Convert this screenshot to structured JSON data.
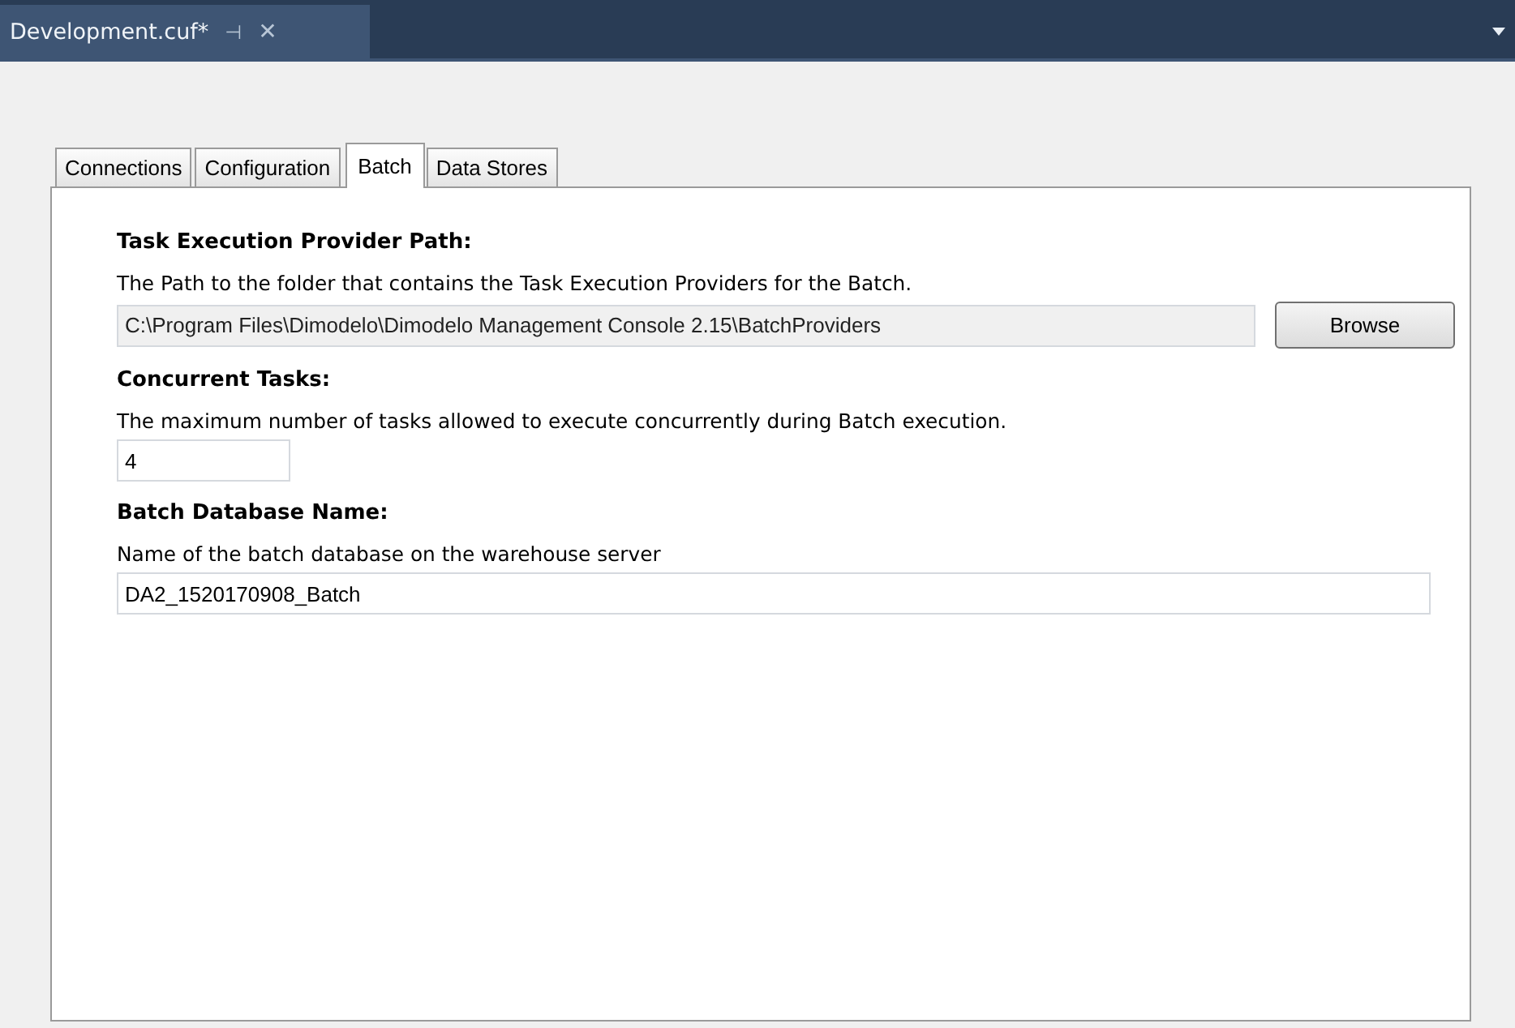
{
  "document_tab": {
    "title": "Development.cuf*",
    "pin": "⊣",
    "close": "✕"
  },
  "tabs": [
    {
      "label": "Connections",
      "selected": false
    },
    {
      "label": "Configuration",
      "selected": false
    },
    {
      "label": "Batch",
      "selected": true
    },
    {
      "label": "Data Stores",
      "selected": false
    }
  ],
  "sections": [
    {
      "kind": "path",
      "heading": "Task Execution Provider Path:",
      "description": "The Path to the folder that contains the Task Execution Providers for the Batch.",
      "value": "C:\\Program Files\\Dimodelo\\Dimodelo Management Console 2.15\\BatchProviders",
      "disabled": true,
      "button": "Browse"
    },
    {
      "kind": "number",
      "heading": "Concurrent Tasks:",
      "description": "The maximum number of tasks allowed to execute concurrently during Batch execution.",
      "value": "4",
      "disabled": false
    },
    {
      "kind": "text",
      "heading": "Batch Database Name:",
      "description": "Name of the batch database on the warehouse server",
      "value": "DA2_1520170908_Batch",
      "disabled": false
    }
  ]
}
